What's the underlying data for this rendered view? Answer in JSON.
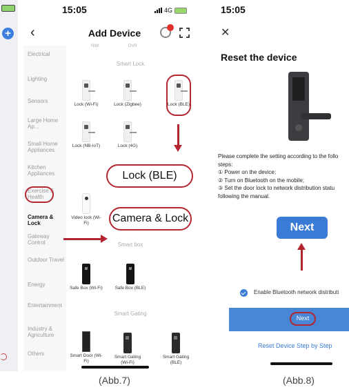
{
  "phone1": {
    "time": "15:05",
    "network": "4G",
    "title": "Add Device",
    "cut_top": [
      "NWI",
      "DVR"
    ],
    "sidebar": [
      {
        "label": "Electrical"
      },
      {
        "label": "Lighting"
      },
      {
        "label": "Sensors"
      },
      {
        "label": "Large Home Ap..."
      },
      {
        "label": "Small Home Appliances"
      },
      {
        "label": "Kitchen Appliances"
      },
      {
        "label": "Exercise & Health"
      },
      {
        "label": "Camera & Lock"
      },
      {
        "label": "Gateway Control"
      },
      {
        "label": "Outdoor Travel"
      },
      {
        "label": "Energy"
      },
      {
        "label": "Entertainment"
      },
      {
        "label": "Industry & Agriculture"
      },
      {
        "label": "Others"
      }
    ],
    "sections": {
      "smart_lock": "Smart Lock",
      "smart_box": "Smart box",
      "smart_gating": "Smart Gating"
    },
    "devices": {
      "lock_wifi": "Lock (Wi-Fi)",
      "lock_zigbee": "Lock (Zigbee)",
      "lock_ble": "Lock (BLE)",
      "lock_nbiot": "Lock (NB-IoT)",
      "lock_4g": "Lock (4G)",
      "video_lock": "Video lock (Wi-Fi)",
      "safe_wifi": "Safe Box (Wi-Fi)",
      "safe_ble": "Safe Box (BLE)",
      "door_wifi": "Smart Door (Wi-Fi)",
      "gating_wifi": "Smart Gating (Wi-Fi)",
      "gating_ble": "Smart Gating (BLE)"
    },
    "callouts": {
      "ble": "Lock (BLE)",
      "camera": "Camera & Lock"
    },
    "caption": "(Abb.7)"
  },
  "phone2": {
    "time": "15:05",
    "title": "Reset the device",
    "steps": [
      "Please complete the setting according to the follo",
      "steps:",
      "① Power on the device;",
      "② Turn on Bluetooth on the mobile;",
      "③ Set the door lock to network distribution statu",
      "following the manual."
    ],
    "next_big": "Next",
    "enable_bt": "Enable Bluetooth network distributi",
    "next_small": "Next",
    "reset_link": "Reset Device Step by Step",
    "caption": "(Abb.8)"
  },
  "colors": {
    "accent_red": "#b3262f",
    "blue": "#3a7bd5"
  }
}
